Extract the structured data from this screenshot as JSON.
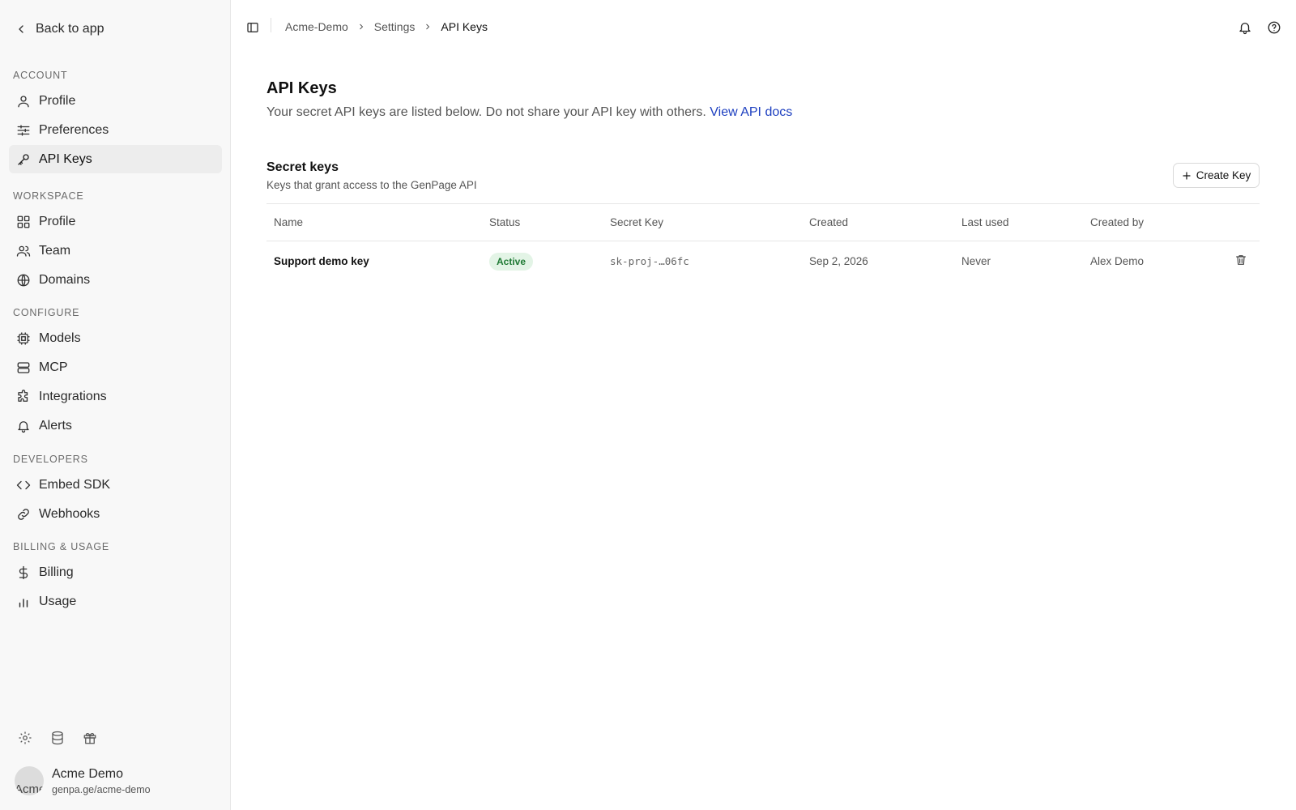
{
  "sidebar": {
    "back_label": "Back to app",
    "sections": {
      "account": "ACCOUNT",
      "workspace": "WORKSPACE",
      "configure": "CONFIGURE",
      "developers": "DEVELOPERS",
      "billing": "BILLING & USAGE"
    },
    "items": {
      "profile": "Profile",
      "preferences": "Preferences",
      "api_keys": "API Keys",
      "ws_profile": "Profile",
      "team": "Team",
      "domains": "Domains",
      "models": "Models",
      "mcp": "MCP",
      "integrations": "Integrations",
      "alerts": "Alerts",
      "embed_sdk": "Embed SDK",
      "webhooks": "Webhooks",
      "billing": "Billing",
      "usage": "Usage"
    },
    "active_item": "api_keys",
    "footer_icons": [
      "settings-icon",
      "database-icon",
      "gift-icon"
    ],
    "user": {
      "avatar_alt": "Acme",
      "name": "Acme Demo",
      "subtitle": "genpa.ge/acme-demo"
    }
  },
  "header": {
    "breadcrumbs": [
      "Acme-Demo",
      "Settings",
      "API Keys"
    ],
    "right_icons": [
      "bell-icon",
      "help-icon"
    ]
  },
  "main": {
    "title": "API Keys",
    "description": "Your secret API keys are listed below. Do not share your API key with others.",
    "docs_link": "View API docs",
    "card": {
      "title": "Secret keys",
      "subtitle": "Keys that grant access to the GenPage API",
      "create_label": "Create Key"
    },
    "table": {
      "columns": [
        "Name",
        "Status",
        "Secret Key",
        "Created",
        "Last used",
        "Created by"
      ],
      "rows": [
        {
          "name": "Support demo key",
          "status": "Active",
          "secret_key": "sk-proj-…06fc",
          "created": "Sep 2, 2026",
          "last_used": "Never",
          "created_by": "Alex Demo"
        }
      ]
    }
  },
  "colors": {
    "link": "#1e40c0",
    "status_active_bg": "#e3f4e6",
    "status_active_text": "#1f7a34",
    "sidebar_bg": "#f8f8f8",
    "active_item_bg": "#ededed"
  }
}
